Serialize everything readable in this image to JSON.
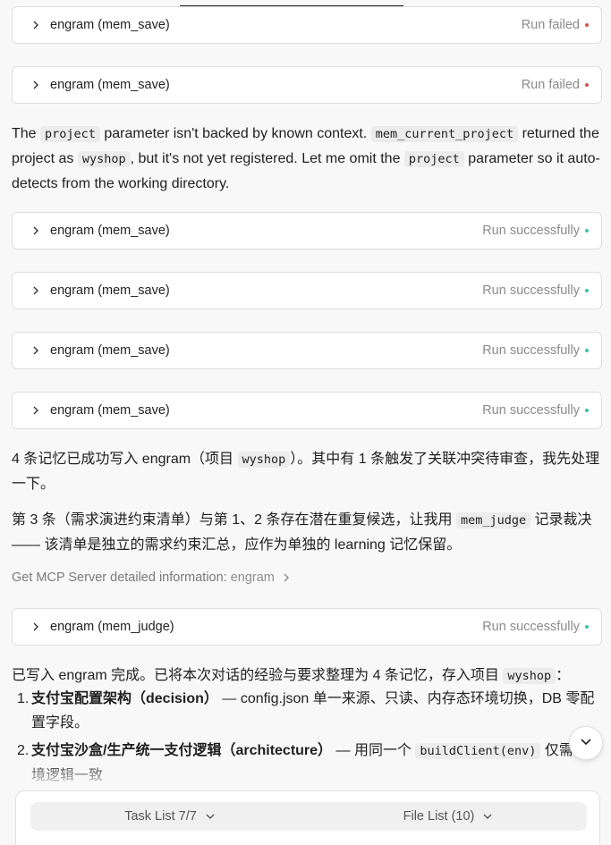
{
  "tool_calls": [
    {
      "name": "engram (mem_save)",
      "status": "Run failed",
      "state": "fail"
    },
    {
      "name": "engram (mem_save)",
      "status": "Run failed",
      "state": "fail"
    },
    {
      "name": "engram (mem_save)",
      "status": "Run successfully",
      "state": "ok"
    },
    {
      "name": "engram (mem_save)",
      "status": "Run successfully",
      "state": "ok"
    },
    {
      "name": "engram (mem_save)",
      "status": "Run successfully",
      "state": "ok"
    },
    {
      "name": "engram (mem_save)",
      "status": "Run successfully",
      "state": "ok"
    },
    {
      "name": "engram (mem_judge)",
      "status": "Run successfully",
      "state": "ok"
    }
  ],
  "para1": {
    "t1": "The ",
    "c1": "project",
    "t2": " parameter isn't backed by known context. ",
    "c2": "mem_current_project",
    "t3": " returned the project as ",
    "c3": "wyshop",
    "t4": ", but it's not yet registered. Let me omit the ",
    "c4": "project",
    "t5": " parameter so it auto-detects from the working directory."
  },
  "para2": {
    "t1": "4 条记忆已成功写入 engram（项目 ",
    "c1": "wyshop",
    "t2": "）。其中有 1 条触发了关联冲突待审查，我先处理一下。"
  },
  "para3": {
    "t1": "第 3 条（需求演进约束清单）与第 1、2 条存在潜在重复候选，让我用 ",
    "c1": "mem_judge",
    "t2": " 记录裁决 —— 该清单是独立的需求约束汇总，应作为单独的 learning 记忆保留。"
  },
  "mcp_info": {
    "label": "Get MCP Server detailed information:",
    "server": "engram"
  },
  "para4": {
    "t1": "已写入 engram 完成。已将本次对话的经验与要求整理为 4 条记忆，存入项目 ",
    "c1": "wyshop",
    "t2": "："
  },
  "summary_items": [
    {
      "num": "1.",
      "bold": "支付宝配置架构（decision）",
      "text": " — config.json 单一来源、只读、内存态环境切换，DB 零配置字段。",
      "code": "",
      "text2": ""
    },
    {
      "num": "2.",
      "bold": "支付宝沙盒/生产统一支付逻辑（architecture）",
      "text": " — 用同一个 ",
      "code": "buildClient(env)",
      "text2": " 仅需在环境逻辑一致"
    }
  ],
  "bottom_tabs": {
    "task_list": "Task List 7/7",
    "file_list": "File List (10)"
  },
  "colors": {
    "fail": "#d9534f",
    "ok": "#3cc4a8"
  }
}
